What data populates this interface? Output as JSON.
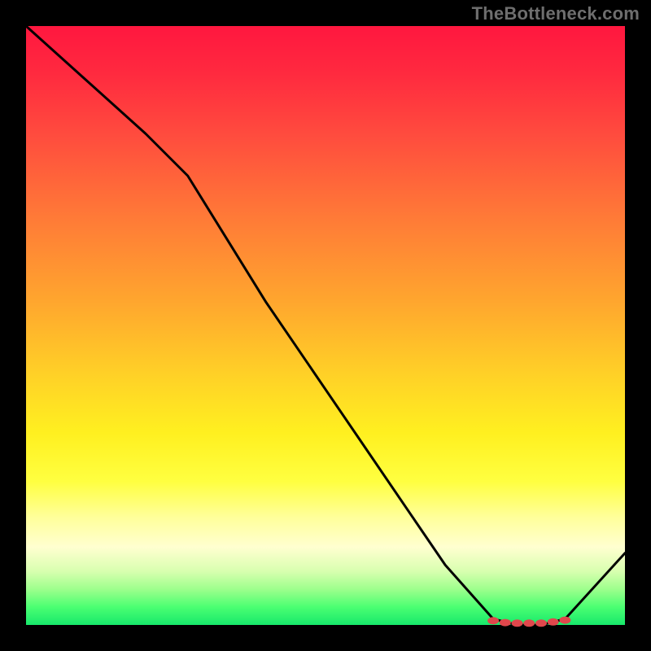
{
  "watermark": "TheBottleneck.com",
  "colors": {
    "frame_bg": "#000000",
    "line": "#000000",
    "marker": "#e0474c",
    "watermark_text": "#6e6e6e"
  },
  "chart_data": {
    "type": "line",
    "title": "",
    "xlabel": "",
    "ylabel": "",
    "xlim": [
      0,
      100
    ],
    "ylim": [
      0,
      100
    ],
    "grid": false,
    "legend": false,
    "series": [
      {
        "name": "curve",
        "x": [
          0,
          10,
          20,
          27,
          40,
          55,
          70,
          78,
          82,
          86,
          90,
          100
        ],
        "y": [
          100,
          91,
          82,
          75,
          54,
          32,
          10,
          1,
          0,
          0,
          1,
          12
        ]
      }
    ],
    "markers": {
      "name": "bottom-cluster",
      "x": [
        78,
        80,
        82,
        84,
        86,
        88,
        90
      ],
      "y": [
        0.7,
        0.4,
        0.3,
        0.3,
        0.3,
        0.5,
        0.8
      ]
    }
  }
}
